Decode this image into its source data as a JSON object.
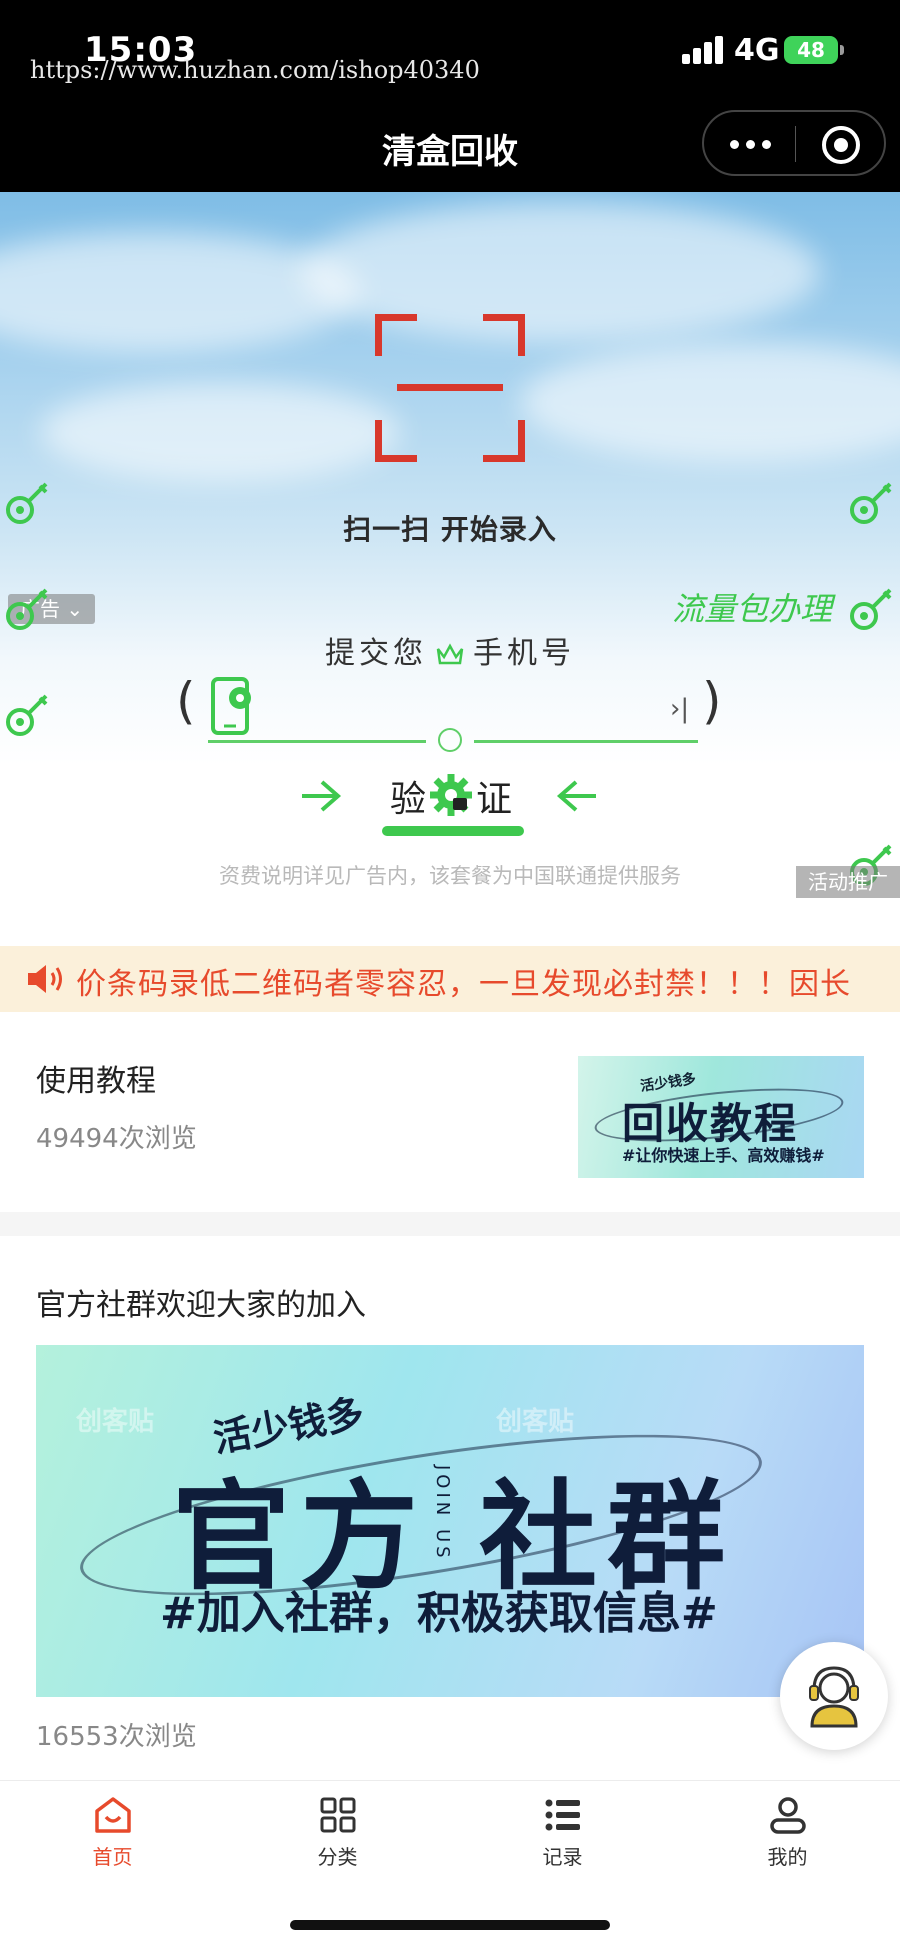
{
  "status_bar": {
    "time": "15:03",
    "network": "4G",
    "battery": "48"
  },
  "watermark_url": "https://www.huzhan.com/ishop40340",
  "nav": {
    "title": "清盒回收"
  },
  "hero": {
    "scan_label": "扫一扫 开始录入",
    "ad_tag": "广告",
    "flow_text": "流量包办理",
    "submit_title_left": "提交您",
    "submit_title_right": "手机号",
    "verify_label": "验证",
    "fee_note": "资费说明详见广告内，该套餐为中国联通提供服务",
    "promo_tag": "活动推广"
  },
  "notice": {
    "text": "价条码录低二维码者零容忍，一旦发现必封禁！！！因长"
  },
  "tutorial_card": {
    "title": "使用教程",
    "views": "49494次浏览",
    "thumb_small": "活少钱多",
    "thumb_big": "回收教程",
    "thumb_sub": "#让你快速上手、高效赚钱#"
  },
  "community_card": {
    "title": "官方社群欢迎大家的加入",
    "views": "16553次浏览",
    "banner_top": "活少钱多",
    "banner_main": "官方 社群",
    "banner_sub": "#加入社群，积极获取信息#",
    "banner_join": "JOIN US",
    "banner_watermark": "创客贴"
  },
  "tabs": [
    {
      "label": "首页",
      "icon": "home-icon",
      "active": true
    },
    {
      "label": "分类",
      "icon": "category-icon",
      "active": false
    },
    {
      "label": "记录",
      "icon": "list-icon",
      "active": false
    },
    {
      "label": "我的",
      "icon": "user-icon",
      "active": false
    }
  ],
  "colors": {
    "accent": "#e74a2c",
    "green": "#3ec84e",
    "scan_red": "#d8382c"
  }
}
